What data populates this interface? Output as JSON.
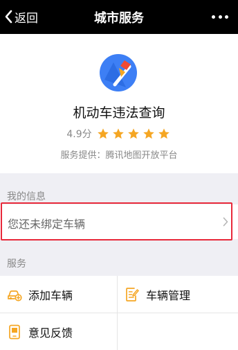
{
  "nav": {
    "back_label": "返回",
    "title": "城市服务",
    "back_icon": "chevron-left-icon",
    "more_icon": "more-dots-icon"
  },
  "app": {
    "name": "机动车违法查询",
    "rating": "4.9分",
    "stars": 5,
    "provider": "服务提供：腾讯地图开放平台",
    "logo_icon": "map-compass-logo"
  },
  "my_info": {
    "section_title": "我的信息",
    "row_label": "您还未绑定车辆"
  },
  "services": {
    "section_title": "服务",
    "items": [
      {
        "label": "添加车辆",
        "icon": "car-add-icon"
      },
      {
        "label": "车辆管理",
        "icon": "edit-document-icon"
      },
      {
        "label": "意见反馈",
        "icon": "feedback-phone-icon"
      }
    ]
  },
  "colors": {
    "accent_orange": "#f5a623",
    "star_gold": "#f5a623",
    "highlight_red": "#e8283a",
    "logo_blue": "#3d7ff5"
  }
}
